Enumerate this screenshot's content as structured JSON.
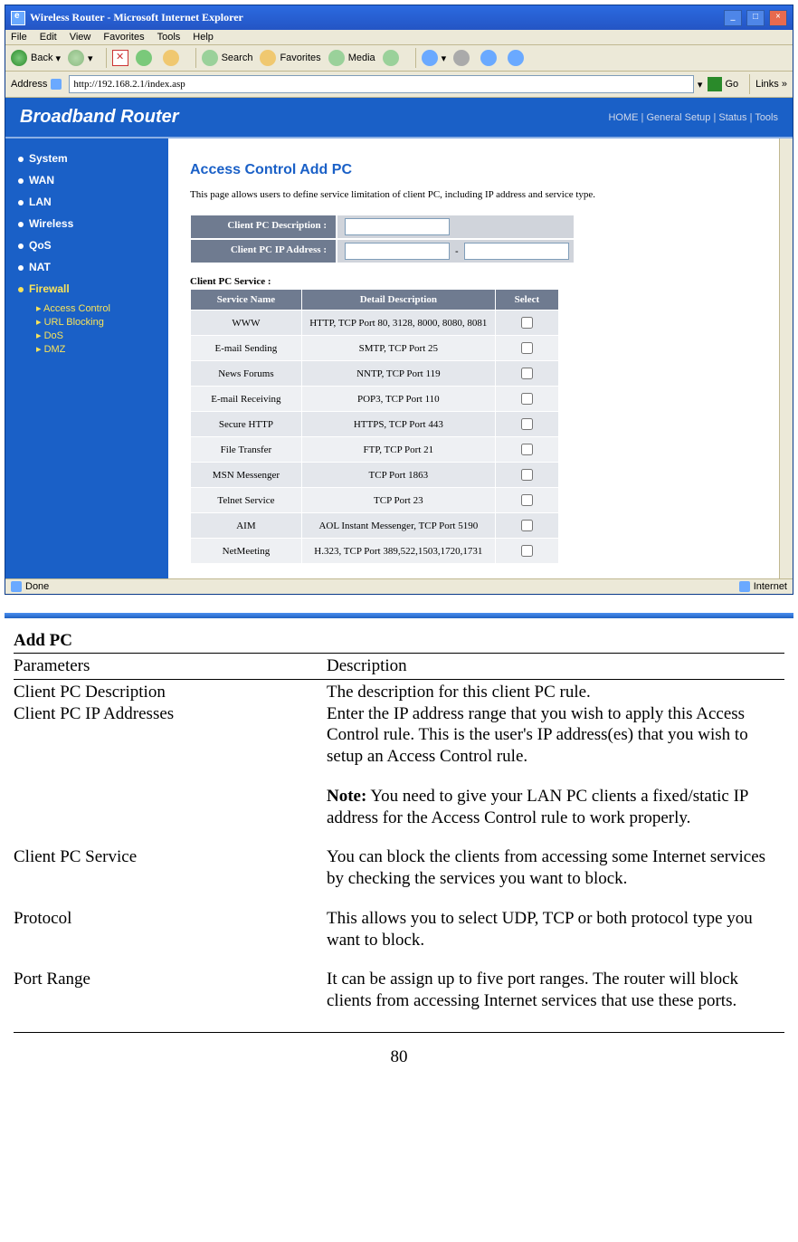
{
  "ie": {
    "title": "Wireless Router - Microsoft Internet Explorer",
    "menu": [
      "File",
      "Edit",
      "View",
      "Favorites",
      "Tools",
      "Help"
    ],
    "toolbar": {
      "back": "Back",
      "search": "Search",
      "favorites": "Favorites",
      "media": "Media"
    },
    "address_label": "Address",
    "url": "http://192.168.2.1/index.asp",
    "go": "Go",
    "links": "Links",
    "done": "Done",
    "internet": "Internet"
  },
  "router": {
    "brand": "Broadband Router",
    "topnav": "HOME | General Setup | Status | Tools",
    "sidebar": {
      "items": [
        {
          "label": "System"
        },
        {
          "label": "WAN"
        },
        {
          "label": "LAN"
        },
        {
          "label": "Wireless"
        },
        {
          "label": "QoS"
        },
        {
          "label": "NAT"
        },
        {
          "label": "Firewall",
          "active": true
        }
      ],
      "sub": [
        "Access Control",
        "URL Blocking",
        "DoS",
        "DMZ"
      ]
    },
    "page_title": "Access Control Add PC",
    "page_desc": "This page allows users to define service limitation of client PC, including IP address and service type.",
    "form": {
      "desc_label": "Client PC Description :",
      "ip_label": "Client PC IP Address :",
      "ip_sep": "-"
    },
    "svc_label": "Client PC Service :",
    "svc_headers": [
      "Service Name",
      "Detail Description",
      "Select"
    ],
    "svc_rows": [
      {
        "name": "WWW",
        "desc": "HTTP, TCP Port 80, 3128, 8000, 8080, 8081"
      },
      {
        "name": "E-mail Sending",
        "desc": "SMTP, TCP Port 25"
      },
      {
        "name": "News Forums",
        "desc": "NNTP, TCP Port 119"
      },
      {
        "name": "E-mail Receiving",
        "desc": "POP3, TCP Port 110"
      },
      {
        "name": "Secure HTTP",
        "desc": "HTTPS, TCP Port 443"
      },
      {
        "name": "File Transfer",
        "desc": "FTP, TCP Port 21"
      },
      {
        "name": "MSN Messenger",
        "desc": "TCP Port 1863"
      },
      {
        "name": "Telnet Service",
        "desc": "TCP Port 23"
      },
      {
        "name": "AIM",
        "desc": "AOL Instant Messenger, TCP Port 5190"
      },
      {
        "name": "NetMeeting",
        "desc": "H.323, TCP Port 389,522,1503,1720,1731"
      }
    ]
  },
  "doc": {
    "title": "Add PC",
    "hdr_param": "Parameters",
    "hdr_desc": "Description",
    "rows": [
      {
        "p": "Client PC Description",
        "d": "The description for this client PC rule."
      },
      {
        "p": "Client PC IP Addresses",
        "d": "Enter the IP address range that you wish to apply this Access Control rule. This is the user's IP address(es) that you wish to setup an Access Control rule.",
        "arial": true,
        "after_space": true
      },
      {
        "note_label": "Note:",
        "note": " You need to give your LAN PC clients a fixed/static IP address for the Access Control rule to work properly.",
        "arial": true,
        "after_space": true
      },
      {
        "p": "Client PC Service",
        "d": "You can block the clients from accessing some Internet services by checking the services you want to block.",
        "after_space": true
      },
      {
        "p": "Protocol",
        "d": "This allows you to select UDP, TCP or both protocol type you want to block.",
        "after_space": true
      },
      {
        "p": "Port Range",
        "d": "It can be assign up to five port ranges. The router will block clients from accessing Internet services that use these ports.",
        "after_space": true
      }
    ],
    "pagenum": "80"
  }
}
